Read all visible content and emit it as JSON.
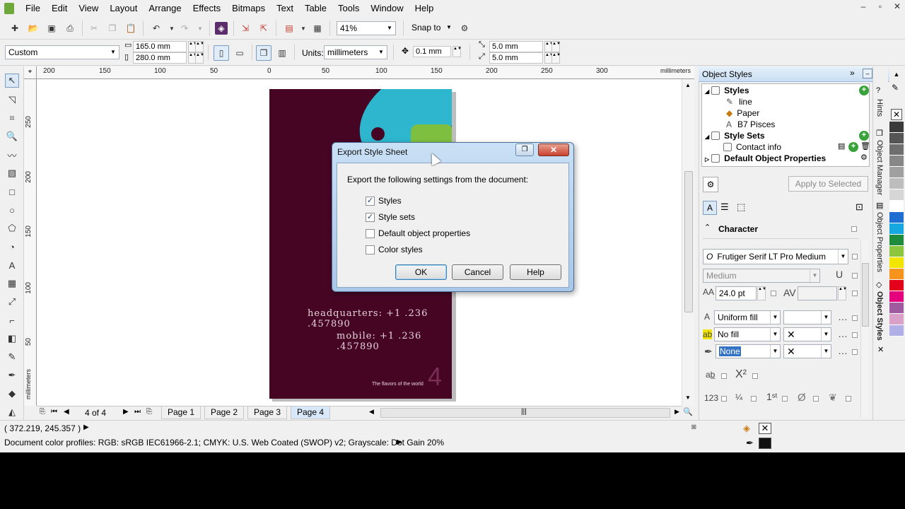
{
  "menubar": {
    "items": [
      "File",
      "Edit",
      "View",
      "Layout",
      "Arrange",
      "Effects",
      "Bitmaps",
      "Text",
      "Table",
      "Tools",
      "Window",
      "Help"
    ]
  },
  "toolbar": {
    "zoom": "41%",
    "snap_to": "Snap to"
  },
  "property_bar": {
    "page_preset": "Custom",
    "width": "165.0 mm",
    "height": "280.0 mm",
    "units_label": "Units:",
    "units_value": "millimeters",
    "nudge": "0.1 mm",
    "dup_x": "5.0 mm",
    "dup_y": "5.0 mm"
  },
  "ruler": {
    "h_ticks": [
      "200",
      "150",
      "100",
      "50",
      "0",
      "50",
      "100",
      "150",
      "200",
      "250",
      "300"
    ],
    "h_unit": "millimeters",
    "v_ticks": [
      "250",
      "200",
      "150",
      "100",
      "50"
    ],
    "v_unit": "millimeters"
  },
  "document": {
    "headquarters": "headquarters: +1 .236 .457890",
    "mobile": "mobile: +1 .236 .457890",
    "tagline": "The flavors of the world",
    "page_number": "4"
  },
  "pagebar": {
    "counter": "4 of 4",
    "tabs": [
      "Page 1",
      "Page 2",
      "Page 3",
      "Page 4"
    ],
    "active": "Page 4"
  },
  "statusbar": {
    "coords": "( 372.219, 245.357 )",
    "color_profiles": "Document color profiles: RGB: sRGB IEC61966-2.1; CMYK: U.S. Web Coated (SWOP) v2; Grayscale: Dot Gain 20%"
  },
  "docker": {
    "title": "Object Styles",
    "tree": {
      "styles": "Styles",
      "line": "line",
      "paper": "Paper",
      "b7": "B7 Pisces",
      "style_sets": "Style Sets",
      "contact": "Contact info",
      "default_props": "Default Object Properties"
    },
    "apply_button": "Apply to Selected",
    "section": "Character",
    "font": "Frutiger Serif LT Pro Medium",
    "weight": "Medium",
    "size": "24.0 pt",
    "fill_type": "Uniform fill",
    "bg_fill": "No fill",
    "outline": "None",
    "tabs": [
      "Hints",
      "Object Manager",
      "Object Properties",
      "Object Styles"
    ]
  },
  "dialog": {
    "title": "Export Style Sheet",
    "prompt": "Export the following settings from the document:",
    "options": [
      {
        "label": "Styles",
        "checked": true
      },
      {
        "label": "Style sets",
        "checked": true
      },
      {
        "label": "Default object properties",
        "checked": false
      },
      {
        "label": "Color styles",
        "checked": false
      }
    ],
    "ok": "OK",
    "cancel": "Cancel",
    "help": "Help"
  },
  "palette": [
    "#3a3a3a",
    "#555555",
    "#6e6e6e",
    "#878787",
    "#a0a0a0",
    "#bdbdbd",
    "#d6d6d6",
    "#ffffff",
    "#1e6ed2",
    "#18a8e0",
    "#1e8c3c",
    "#8cc63f",
    "#f2e600",
    "#f7941d",
    "#e2001a",
    "#e5007e",
    "#a05aa0",
    "#d9a0c8",
    "#b0b0e6"
  ]
}
